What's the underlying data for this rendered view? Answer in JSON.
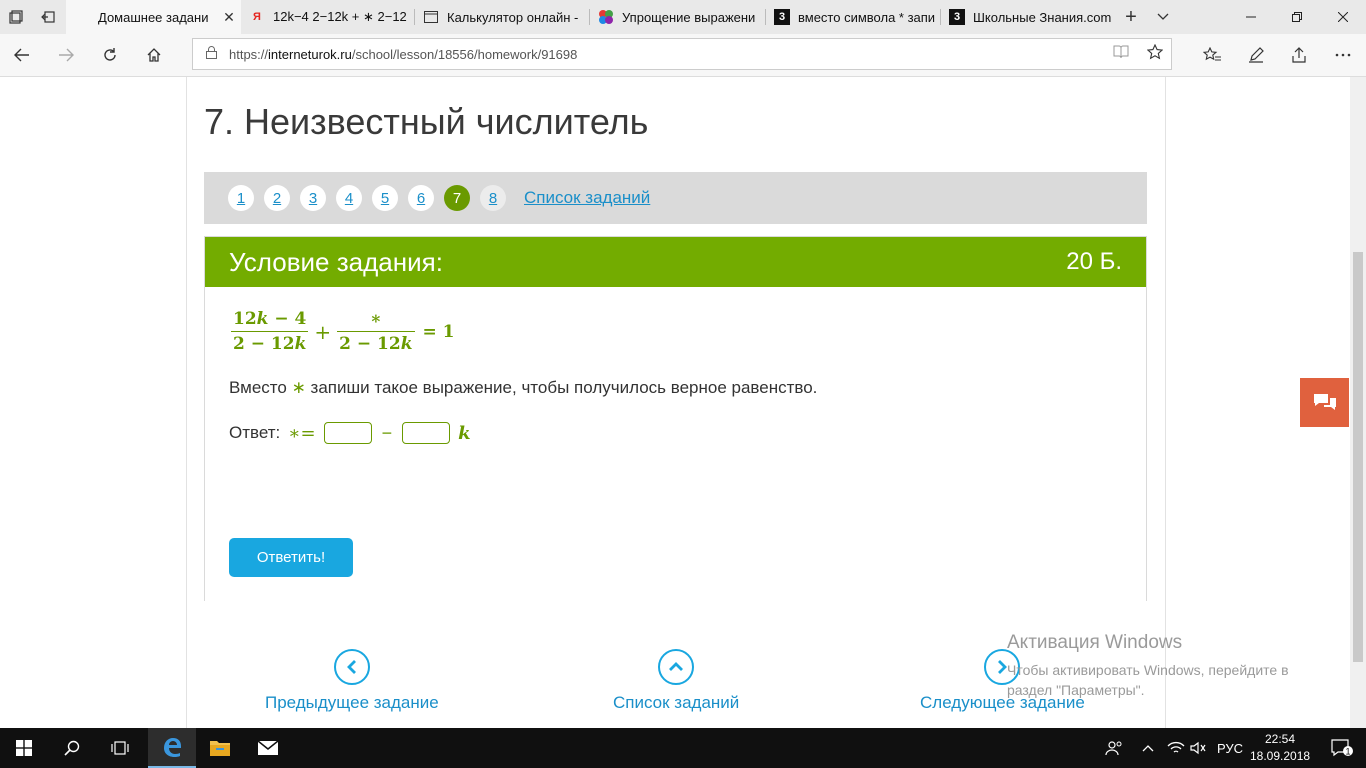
{
  "browser": {
    "tabs": [
      {
        "title": "Домашнее задани",
        "icon": "interneturok-favicon",
        "active": true
      },
      {
        "title": "12k−4 2−12k + ∗ 2−12",
        "icon": "yandex-favicon"
      },
      {
        "title": "Калькулятор онлайн -",
        "icon": "page-favicon"
      },
      {
        "title": "Упрощение выражени",
        "icon": "colorful-favicon"
      },
      {
        "title": "вместо символа * запи",
        "icon": "znanija-favicon"
      },
      {
        "title": "Школьные Знания.com",
        "icon": "znanija-favicon"
      }
    ],
    "tab_icon_labels": {
      "yandex": "Я",
      "znanija": "3"
    },
    "url_scheme": "https://",
    "url_host": "interneturok.ru",
    "url_path": "/school/lesson/18556/homework/91698"
  },
  "page": {
    "title": "7. Неизвестный числитель",
    "pager": {
      "numbers": [
        "1",
        "2",
        "3",
        "4",
        "5",
        "6",
        "7",
        "8"
      ],
      "current": "7",
      "list_link": "Список заданий"
    },
    "task": {
      "header_title": "Условие задания:",
      "score": "20 Б.",
      "formula": {
        "frac1_num_a": "12",
        "frac1_num_var": "k",
        "frac1_num_b": " − 4",
        "frac1_den_a": "2 − 12",
        "frac1_den_var": "k",
        "plus": "+",
        "frac2_num": "∗",
        "frac2_den_a": "2 − 12",
        "frac2_den_var": "k",
        "rhs": "= 1"
      },
      "instruction_before": "Вместо ",
      "instruction_star": "∗",
      "instruction_after": " запиши такое выражение, чтобы получилось верное равенство.",
      "answer_label": "Ответ:",
      "answer_lhs": "∗=",
      "answer_minus": "−",
      "answer_var": "k",
      "answer_box1_value": "",
      "answer_box2_value": "",
      "submit_label": "Ответить!"
    },
    "bottom_nav": {
      "prev_label": "Предыдущее задание",
      "list_label": "Список заданий",
      "next_label": "Следующее задание"
    },
    "watermark": {
      "title": "Активация Windows",
      "text": "Чтобы активировать Windows, перейдите в раздел \"Параметры\"."
    }
  },
  "taskbar": {
    "language": "РУС",
    "time": "22:54",
    "date": "18.09.2018",
    "notification_count": "1"
  },
  "colors": {
    "accent_green": "#73ac00",
    "formula_green": "#6a9a00",
    "link_blue": "#1a8fc9",
    "button_blue": "#19a7e0",
    "chat_orange": "#e0613e"
  }
}
